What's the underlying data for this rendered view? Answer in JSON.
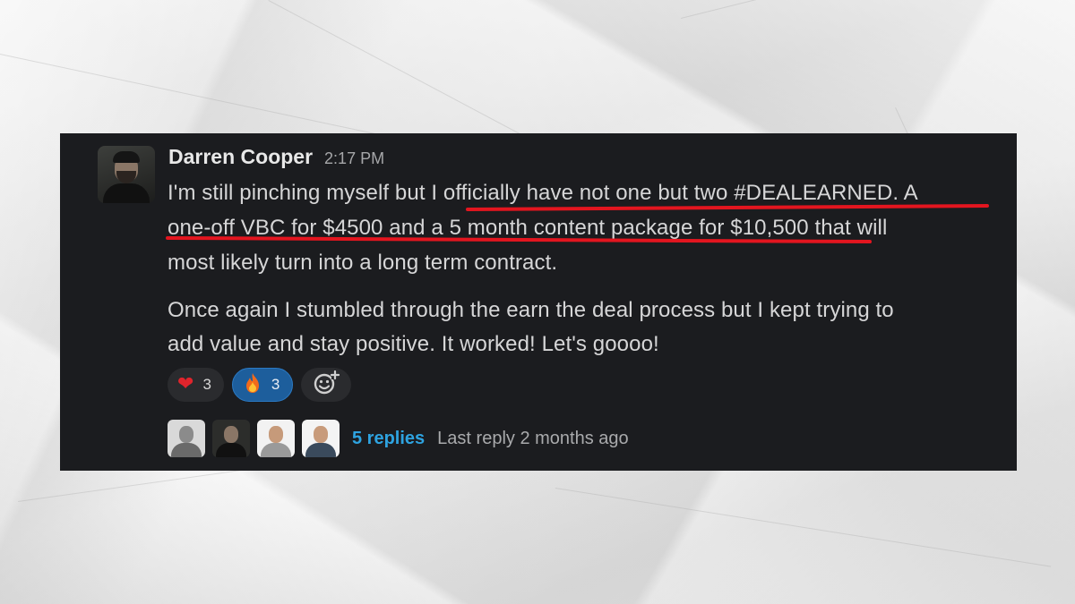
{
  "message": {
    "author": "Darren Cooper",
    "time": "2:17 PM",
    "paragraph1": {
      "line1_plain": "I'm still pinching myself but ",
      "line1_highlight": "I officially have not one but two #DEALEARNED. A",
      "line2_highlight": "one-off VBC for $4500 and a 5 month content package for $10,500",
      "line2_plain": " that will",
      "line3_plain": "most likely turn into a long term contract."
    },
    "paragraph2": {
      "line1": "Once again I stumbled through the earn the deal process but I kept trying to",
      "line2": "add value and stay positive. It worked! Let's goooo!"
    },
    "highlight_color": "#e3151f"
  },
  "reactions": [
    {
      "emoji": "❤",
      "icon": "heart-icon",
      "count": "3",
      "active": false
    },
    {
      "emoji": "🔥",
      "icon": "fire-icon",
      "count": "3",
      "active": true
    }
  ],
  "add_reaction": {
    "icon": "add-reaction-icon"
  },
  "thread": {
    "replies_label": "5 replies",
    "last_reply_label": "Last reply 2 months ago",
    "link_color": "#2ea3e0"
  }
}
